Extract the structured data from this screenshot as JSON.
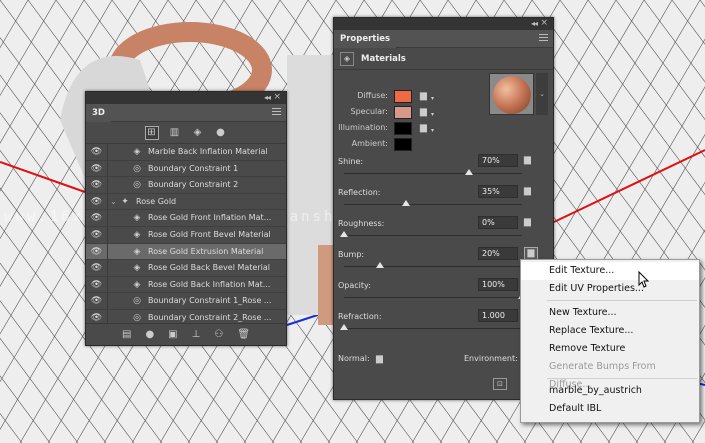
{
  "watermark": "www.16xx8.com  www.hbovidianshell.com",
  "panel_3d": {
    "tab_label": "3D",
    "tools": [
      "scene-icon",
      "mesh-icon",
      "material-icon",
      "light-icon"
    ],
    "layers": [
      {
        "label": "Marble Back Inflation Material",
        "visible": true,
        "icon": "material-icon",
        "indent": 2,
        "selected": false
      },
      {
        "label": "Boundary Constraint 1",
        "visible": true,
        "icon": "constraint-icon",
        "indent": 2,
        "selected": false
      },
      {
        "label": "Boundary Constraint 2",
        "visible": true,
        "icon": "constraint-icon",
        "indent": 2,
        "selected": false
      },
      {
        "label": "Rose Gold",
        "visible": true,
        "icon": "mesh-icon",
        "indent": 1,
        "selected": false,
        "group": true
      },
      {
        "label": "Rose Gold Front Inflation Mat...",
        "visible": true,
        "icon": "material-icon",
        "indent": 2,
        "selected": false
      },
      {
        "label": "Rose Gold Front Bevel Material",
        "visible": true,
        "icon": "material-icon",
        "indent": 2,
        "selected": false
      },
      {
        "label": "Rose Gold Extrusion Material",
        "visible": true,
        "icon": "material-icon",
        "indent": 2,
        "selected": true
      },
      {
        "label": "Rose Gold Back Bevel Material",
        "visible": true,
        "icon": "material-icon",
        "indent": 2,
        "selected": false
      },
      {
        "label": "Rose Gold Back Inflation Mat...",
        "visible": true,
        "icon": "material-icon",
        "indent": 2,
        "selected": false
      },
      {
        "label": "Boundary Constraint 1_Rose ...",
        "visible": true,
        "icon": "constraint-icon",
        "indent": 2,
        "selected": false
      },
      {
        "label": "Boundary Constraint 2_Rose ...",
        "visible": true,
        "icon": "constraint-icon",
        "indent": 2,
        "selected": false
      }
    ],
    "bottom_tools": [
      "delete-icon",
      "add-light-icon",
      "render-icon",
      "ground-icon",
      "constraint-add-icon",
      "trash-icon"
    ]
  },
  "properties": {
    "tab_label": "Properties",
    "section_title": "Materials",
    "swatches": [
      {
        "label": "Diffuse:",
        "color": "#ee6a45"
      },
      {
        "label": "Specular:",
        "color": "#d8998a"
      },
      {
        "label": "Illumination:",
        "color": "#000000"
      },
      {
        "label": "Ambient:",
        "color": "#000000"
      }
    ],
    "props": [
      {
        "label": "Shine:",
        "value": "70%",
        "fraction": 0.7
      },
      {
        "label": "Reflection:",
        "value": "35%",
        "fraction": 0.35
      },
      {
        "label": "Roughness:",
        "value": "0%",
        "fraction": 0.0
      },
      {
        "label": "Bump:",
        "value": "20%",
        "fraction": 0.2
      },
      {
        "label": "Opacity:",
        "value": "100%",
        "fraction": 1.0
      },
      {
        "label": "Refraction:",
        "value": "1.000",
        "fraction": 0.0
      }
    ],
    "normal_label": "Normal:",
    "environment_label": "Environment:"
  },
  "context_menu": {
    "items": [
      {
        "label": "Edit Texture...",
        "highlighted": true,
        "disabled": false
      },
      {
        "label": "Edit UV Properties...",
        "highlighted": false,
        "disabled": false
      },
      {
        "divider": true
      },
      {
        "label": "New Texture...",
        "highlighted": false,
        "disabled": false
      },
      {
        "label": "Replace Texture...",
        "highlighted": false,
        "disabled": false
      },
      {
        "label": "Remove Texture",
        "highlighted": false,
        "disabled": false
      },
      {
        "label": "Generate Bumps From Diffuse...",
        "highlighted": false,
        "disabled": true
      },
      {
        "divider": true
      },
      {
        "label": "marble_by_austrich",
        "highlighted": false,
        "disabled": false
      },
      {
        "label": "Default IBL",
        "highlighted": false,
        "disabled": false
      }
    ]
  }
}
